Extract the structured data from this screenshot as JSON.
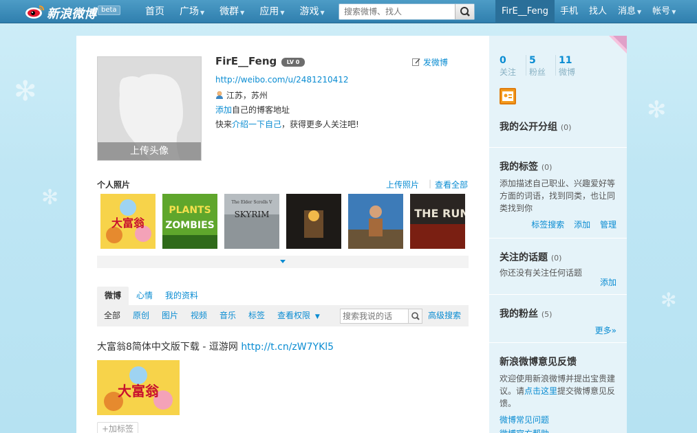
{
  "topbar": {
    "logo_text": "新浪微博",
    "beta": "beta",
    "nav": [
      {
        "label": "首页",
        "caret": false
      },
      {
        "label": "广场",
        "caret": true
      },
      {
        "label": "微群",
        "caret": true
      },
      {
        "label": "应用",
        "caret": true
      },
      {
        "label": "游戏",
        "caret": true
      }
    ],
    "search_placeholder": "搜索微博、找人",
    "right_nav": [
      {
        "label": "FirE__Feng",
        "caret": false
      },
      {
        "label": "手机",
        "caret": false
      },
      {
        "label": "找人",
        "caret": false
      },
      {
        "label": "消息",
        "caret": true
      },
      {
        "label": "帐号",
        "caret": true
      }
    ]
  },
  "profile": {
    "avatar_upload": "上传头像",
    "username": "FirE__Feng",
    "level": "LV 0",
    "post_button": "发微博",
    "url": "http://weibo.com/u/2481210412",
    "location": "江苏，苏州",
    "blog_link": "添加",
    "blog_text": "自己的博客地址",
    "intro_prefix": "快来",
    "intro_link": "介绍一下自己",
    "intro_suffix": "，获得更多人关注吧!"
  },
  "photos": {
    "title": "个人照片",
    "upload": "上传照片",
    "sep": "|",
    "view_all": "查看全部",
    "items": [
      "dafuweng",
      "plants-vs-zombies",
      "skyrim",
      "torchlight",
      "enslaved",
      "need-for-speed-the-run"
    ],
    "texts": [
      "大富翁",
      "PLANTS",
      "ZOMBIES",
      "SKYRIM",
      "The Elder Scrolls V",
      "THE RUN"
    ]
  },
  "tabs": {
    "items": [
      "微博",
      "心情",
      "我的资料"
    ]
  },
  "filters": {
    "items": [
      "全部",
      "原创",
      "图片",
      "视频",
      "音乐",
      "标签",
      "查看权限"
    ],
    "search_placeholder": "搜索我说的话",
    "advanced": "高级搜索"
  },
  "post": {
    "text": "大富翁8简体中文版下载 - 逗游网 ",
    "link": "http://t.cn/zW7YKl5",
    "image_text": "大富翁",
    "add_tag": "+加标签"
  },
  "sidebar": {
    "stats": [
      {
        "num": "0",
        "label": "关注"
      },
      {
        "num": "5",
        "label": "粉丝"
      },
      {
        "num": "11",
        "label": "微博"
      }
    ],
    "groups": {
      "title": "我的公开分组",
      "count": "(0)"
    },
    "tags": {
      "title": "我的标签",
      "count": "(0)",
      "text": "添加描述自己职业、兴趣爱好等方面的词语，找到同类，也让同类找到你",
      "actions": [
        "标签搜索",
        "添加",
        "管理"
      ]
    },
    "topics": {
      "title": "关注的话题",
      "count": "(0)",
      "text": "你还没有关注任何话题",
      "action": "添加"
    },
    "fans": {
      "title": "我的粉丝",
      "count": "(5)",
      "more": "更多»"
    },
    "feedback": {
      "title": "新浪微博意见反馈",
      "text1": "欢迎使用新浪微博并提出宝贵建议。请",
      "link": "点击这里",
      "text2": "提交微博意见反馈。",
      "faq": "微博常见问题",
      "help": "微博官方帮助"
    }
  },
  "colors": {
    "accent": "#0a8cd2",
    "nav_bg": "#3a86b6",
    "bg": "#c3e8f5"
  }
}
